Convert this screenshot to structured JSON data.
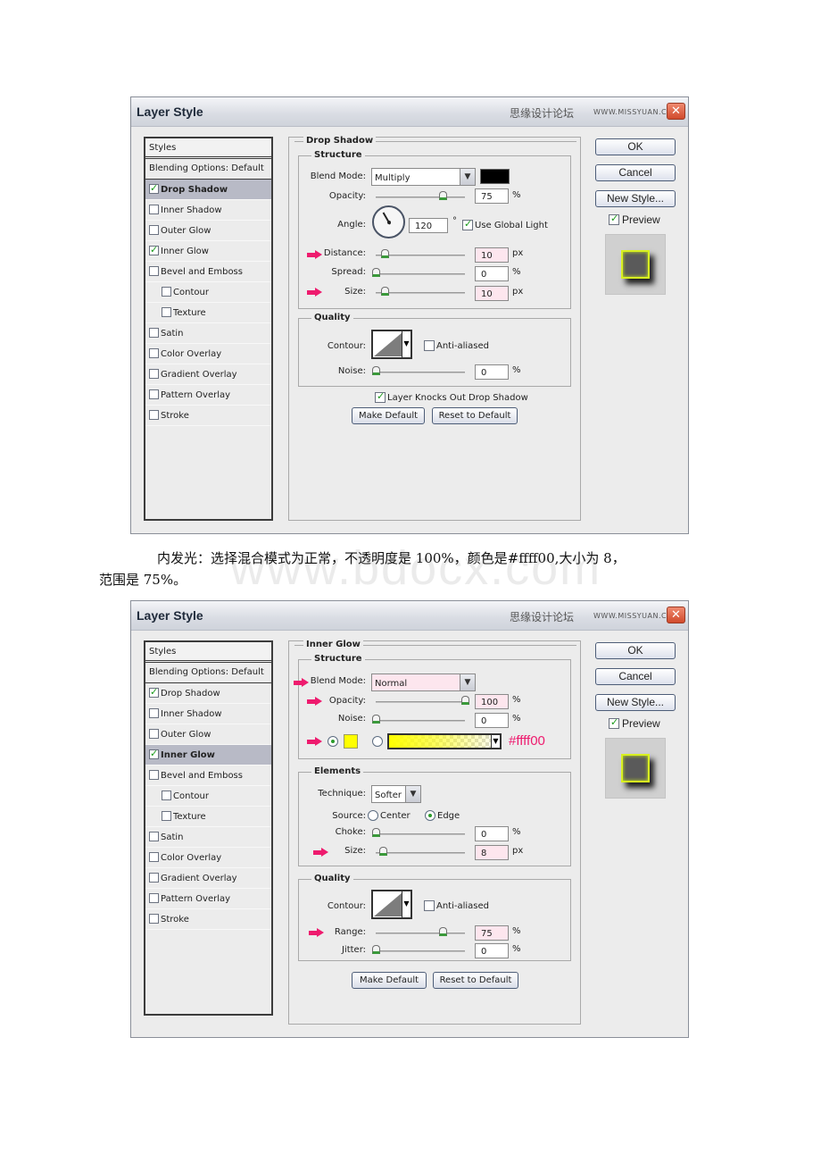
{
  "watermark": "www.bdocx.com",
  "caption": {
    "line1": "内发光：选择混合模式为正常，不透明度是 100%，颜色是#ffff00,大小为 8，",
    "line2": "范围是 75%。"
  },
  "dialog_common": {
    "title": "Layer Style",
    "site_cn": "思缘设计论坛",
    "site_url": "WWW.MISSYUAN.COM",
    "close_glyph": "✕",
    "ok": "OK",
    "cancel": "Cancel",
    "new_style": "New Style...",
    "preview": "Preview",
    "styles_header": "Styles",
    "blending_options": "Blending Options: Default",
    "make_default": "Make Default",
    "reset_default": "Reset to Default"
  },
  "dialog1": {
    "style_items": [
      {
        "label": "Drop Shadow",
        "checked": true,
        "selected": true
      },
      {
        "label": "Inner Shadow",
        "checked": false
      },
      {
        "label": "Outer Glow",
        "checked": false
      },
      {
        "label": "Inner Glow",
        "checked": true
      },
      {
        "label": "Bevel and Emboss",
        "checked": false
      },
      {
        "label": "Contour",
        "checked": false,
        "sub": true
      },
      {
        "label": "Texture",
        "checked": false,
        "sub": true
      },
      {
        "label": "Satin",
        "checked": false
      },
      {
        "label": "Color Overlay",
        "checked": false
      },
      {
        "label": "Gradient Overlay",
        "checked": false
      },
      {
        "label": "Pattern Overlay",
        "checked": false
      },
      {
        "label": "Stroke",
        "checked": false
      }
    ],
    "section": "Drop Shadow",
    "structure": "Structure",
    "blend_mode_label": "Blend Mode:",
    "blend_mode": "Multiply",
    "shadow_color": "#000000",
    "opacity_label": "Opacity:",
    "opacity": "75",
    "opacity_unit": "%",
    "angle_label": "Angle:",
    "angle": "120",
    "angle_unit": "°",
    "use_global_light": "Use Global Light",
    "distance_label": "Distance:",
    "distance": "10",
    "distance_unit": "px",
    "spread_label": "Spread:",
    "spread": "0",
    "spread_unit": "%",
    "size_label": "Size:",
    "size": "10",
    "size_unit": "px",
    "quality": "Quality",
    "contour_label": "Contour:",
    "anti_aliased": "Anti-aliased",
    "noise_label": "Noise:",
    "noise": "0",
    "noise_unit": "%",
    "knocks_out": "Layer Knocks Out Drop Shadow",
    "slider_fractions": {
      "opacity": 0.75,
      "distance": 0.1,
      "spread": 0,
      "size": 0.1,
      "noise": 0
    }
  },
  "dialog2": {
    "style_items": [
      {
        "label": "Drop Shadow",
        "checked": true
      },
      {
        "label": "Inner Shadow",
        "checked": false
      },
      {
        "label": "Outer Glow",
        "checked": false
      },
      {
        "label": "Inner Glow",
        "checked": true,
        "selected": true
      },
      {
        "label": "Bevel and Emboss",
        "checked": false
      },
      {
        "label": "Contour",
        "checked": false,
        "sub": true
      },
      {
        "label": "Texture",
        "checked": false,
        "sub": true
      },
      {
        "label": "Satin",
        "checked": false
      },
      {
        "label": "Color Overlay",
        "checked": false
      },
      {
        "label": "Gradient Overlay",
        "checked": false
      },
      {
        "label": "Pattern Overlay",
        "checked": false
      },
      {
        "label": "Stroke",
        "checked": false
      }
    ],
    "section": "Inner Glow",
    "structure": "Structure",
    "blend_mode_label": "Blend Mode:",
    "blend_mode": "Normal",
    "opacity_label": "Opacity:",
    "opacity": "100",
    "opacity_unit": "%",
    "noise_label": "Noise:",
    "noise": "0",
    "noise_unit": "%",
    "glow_color": "#ffff00",
    "hex_annotation": "#ffff00",
    "elements": "Elements",
    "technique_label": "Technique:",
    "technique": "Softer",
    "source_label": "Source:",
    "source_center": "Center",
    "source_edge": "Edge",
    "choke_label": "Choke:",
    "choke": "0",
    "choke_unit": "%",
    "size_label": "Size:",
    "size": "8",
    "size_unit": "px",
    "quality": "Quality",
    "contour_label": "Contour:",
    "anti_aliased": "Anti-aliased",
    "range_label": "Range:",
    "range": "75",
    "range_unit": "%",
    "jitter_label": "Jitter:",
    "jitter": "0",
    "jitter_unit": "%",
    "slider_fractions": {
      "opacity": 1.0,
      "noise": 0,
      "choke": 0,
      "size": 0.08,
      "range": 0.75,
      "jitter": 0
    }
  },
  "colors": {
    "annotation_pink": "#ee1b6e",
    "highlight_field": "#fde6ee",
    "selected_row": "#b8bac6"
  }
}
